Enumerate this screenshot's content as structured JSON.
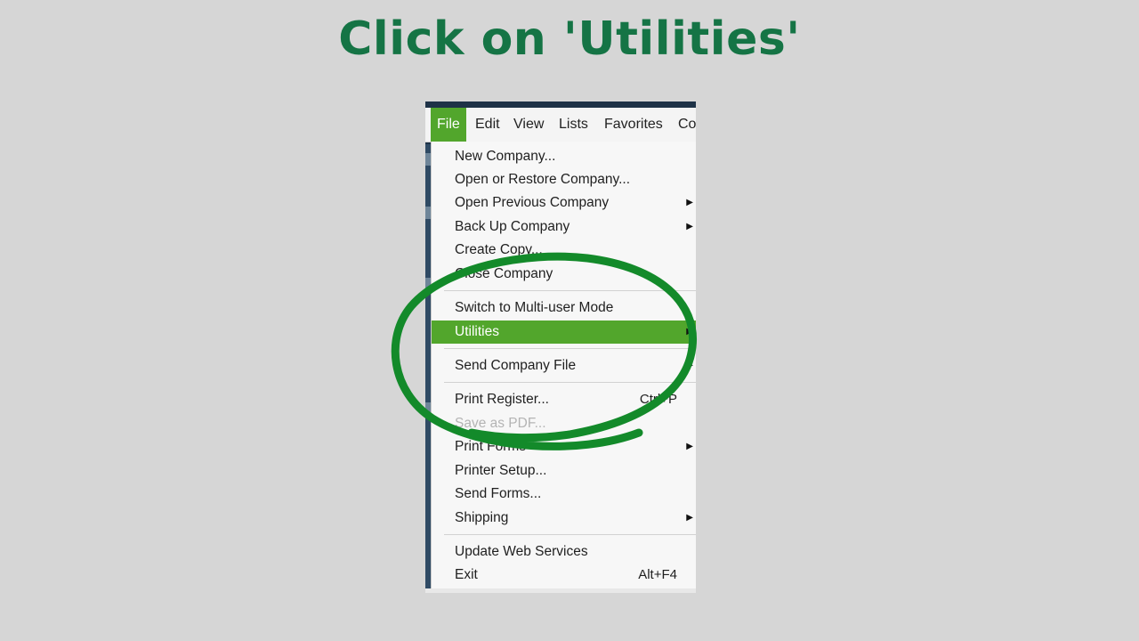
{
  "caption": "Click on 'Utilities'",
  "menubar": {
    "items": [
      {
        "label": "File",
        "active": true
      },
      {
        "label": "Edit"
      },
      {
        "label": "View"
      },
      {
        "label": "Lists"
      },
      {
        "label": "Favorites"
      },
      {
        "label": "Co"
      }
    ]
  },
  "file_menu": {
    "items": [
      {
        "label": "New Company..."
      },
      {
        "label": "Open or Restore Company..."
      },
      {
        "label": "Open Previous Company",
        "submenu": true
      },
      {
        "label": "Back Up Company",
        "submenu": true
      },
      {
        "label": "Create Copy..."
      },
      {
        "label": "Close Company"
      },
      {
        "label": "Switch to Multi-user Mode"
      },
      {
        "label": "Utilities",
        "highlighted": true,
        "submenu": true
      },
      {
        "label": "Send Company File",
        "submenu": true
      },
      {
        "label": "Print Register...",
        "shortcut": "Ctrl+P"
      },
      {
        "label": "Save as PDF...",
        "disabled": true
      },
      {
        "label": "Print Forms",
        "submenu": true
      },
      {
        "label": "Printer Setup..."
      },
      {
        "label": "Send Forms..."
      },
      {
        "label": "Shipping",
        "submenu": true
      },
      {
        "label": "Update Web Services"
      },
      {
        "label": "Exit",
        "shortcut": "Alt+F4"
      }
    ]
  },
  "colors": {
    "caption": "#157445",
    "highlight": "#52a62c",
    "annotation_circle": "#138a2a",
    "background": "#d6d6d6"
  },
  "icons": {
    "submenu_arrow": "triangle-right-icon"
  }
}
